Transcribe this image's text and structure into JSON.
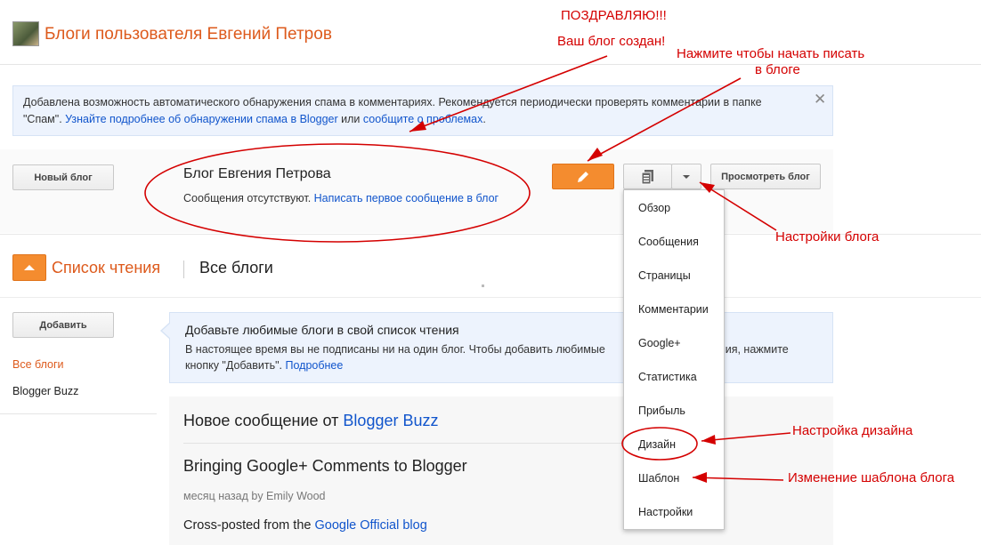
{
  "header": {
    "title": "Блоги пользователя Евгений Петров"
  },
  "notice": {
    "text": "Добавлена возможность автоматического обнаружения спама в комментариях. Рекомендуется периодически проверять комментарии в папке \"Спам\". ",
    "link1": "Узнайте подробнее об обнаружении спама в Blogger",
    "middle": " или ",
    "link2": "сообщите о проблемах",
    "end": ".",
    "close": "✕"
  },
  "blog": {
    "new_blog_button": "Новый блог",
    "name": "Блог Евгения Петрова",
    "status": "Сообщения отсутствуют. ",
    "write_first_link": "Написать первое сообщение в блог",
    "view_button": "Просмотреть блог"
  },
  "reading_list": {
    "title": "Список чтения",
    "all_blogs_heading": "Все блоги",
    "add_button": "Добавить",
    "sidebar": [
      "Все блоги",
      "Blogger Buzz"
    ],
    "panel_title": "Добавьте любимые блоги в свой список чтения",
    "panel_text1": "В настоящее время вы не подписаны ни на один блог. Чтобы добавить любимые",
    "panel_text1b": "ния, нажмите",
    "panel_text2": "кнопку \"Добавить\". ",
    "panel_link": "Подробнее"
  },
  "feed": {
    "heading_prefix": "Новое сообщение от ",
    "heading_link": "Blogger Buzz",
    "post_title": "Bringing Google+ Comments to Blogger",
    "post_meta": "месяц назад by Emily Wood",
    "post_text": "Cross-posted from the ",
    "post_link": "Google Official blog"
  },
  "menu": {
    "items": [
      "Обзор",
      "Сообщения",
      "Страницы",
      "Комментарии",
      "Google+",
      "Статистика",
      "Прибыль",
      "Дизайн",
      "Шаблон",
      "Настройки"
    ]
  },
  "annotations": {
    "congrats": "ПОЗДРАВЛЯЮ!!!",
    "created": "Ваш блог создан!",
    "click_write_1": "Нажмите чтобы начать писать",
    "click_write_2": "в блоге",
    "blog_settings": "Настройки блога",
    "design_settings": "Настройка дизайна",
    "template_change": "Изменение шаблона блога"
  },
  "colors": {
    "accent_orange": "#f48c2f",
    "link_blue": "#1155cc",
    "annotation_red": "#d40000",
    "title_orange": "#dd5a1c"
  },
  "icons": {
    "edit": "pencil-icon",
    "posts": "document-icon",
    "dropdown": "caret-down-icon",
    "reading_list": "caret-up-icon"
  }
}
